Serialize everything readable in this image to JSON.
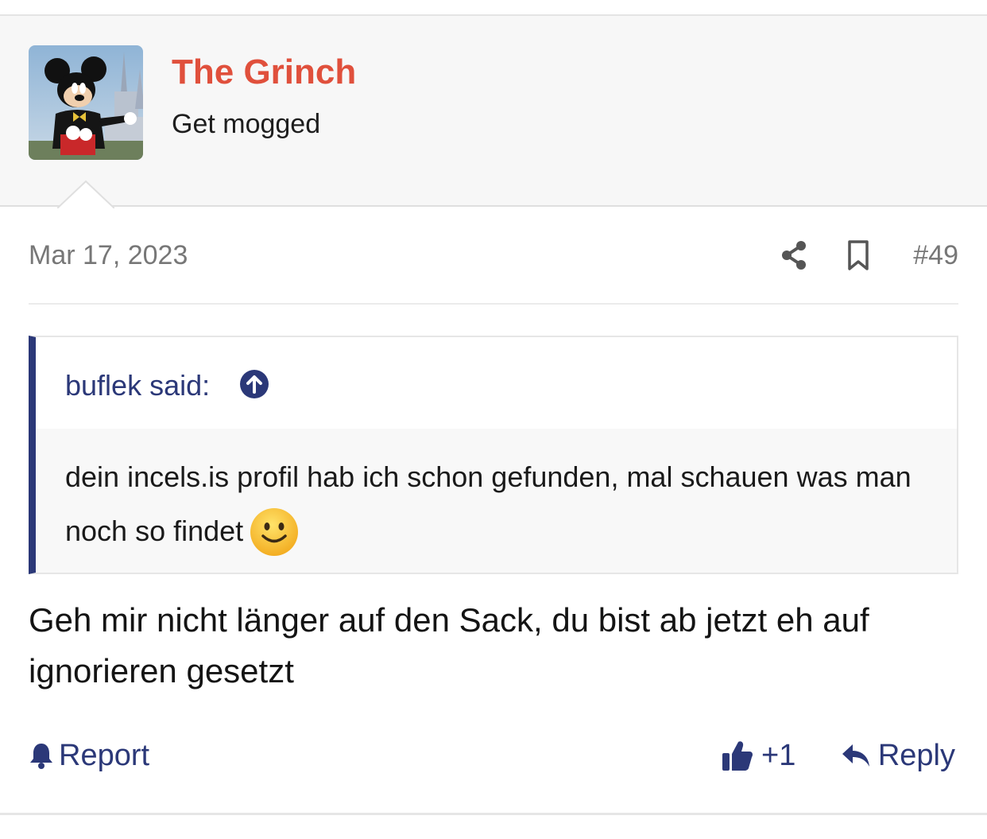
{
  "post": {
    "author": {
      "username": "The Grinch",
      "title": "Get mogged",
      "avatar_icon": "mickey-mouse-castle-photo"
    },
    "date": "Mar 17, 2023",
    "number": "#49",
    "quote": {
      "author_label": "buflek said:",
      "text": "dein incels.is profil hab ich schon gefunden, mal schauen was man noch so findet",
      "emoji": "slightly-smiling-face"
    },
    "message": "Geh mir nicht länger auf den Sack, du bist ab jetzt eh auf ignorieren gesetzt",
    "actions": {
      "report_label": "Report",
      "like_label": "+1",
      "reply_label": "Reply"
    }
  },
  "colors": {
    "username": "#e0503c",
    "link": "#2b3878",
    "muted": "#777777"
  }
}
